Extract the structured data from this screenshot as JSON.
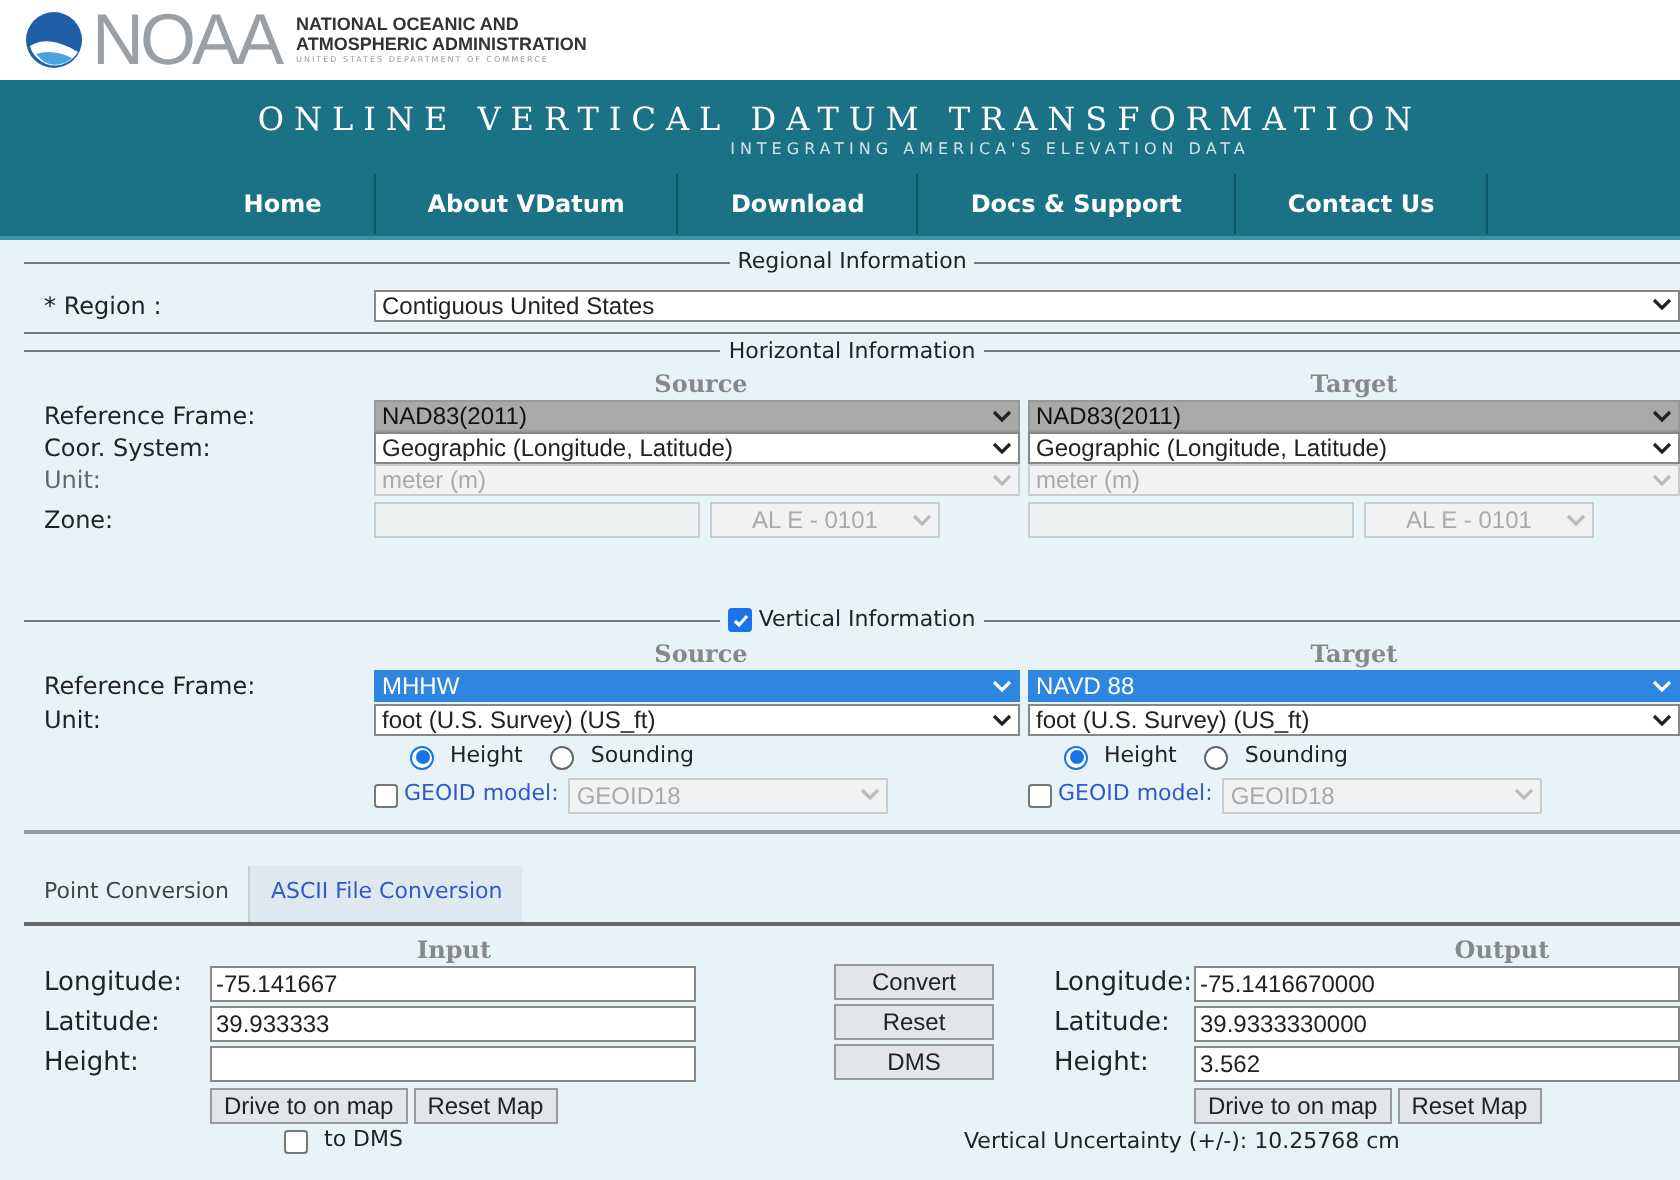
{
  "header": {
    "logo_text": "NOAA",
    "org_lines": [
      "NATIONAL OCEANIC AND",
      "ATMOSPHERIC ADMINISTRATION"
    ],
    "dept": "UNITED STATES DEPARTMENT OF COMMERCE",
    "title": "ONLINE VERTICAL DATUM TRANSFORMATION",
    "subtitle": "INTEGRATING AMERICA'S ELEVATION DATA",
    "nav": [
      {
        "label": "Home"
      },
      {
        "label": "About VDatum"
      },
      {
        "label": "Download"
      },
      {
        "label": "Docs & Support"
      },
      {
        "label": "Contact Us"
      }
    ]
  },
  "regional": {
    "legend": "Regional Information",
    "label": "* Region :",
    "value": "Contiguous United States"
  },
  "horizontal": {
    "legend": "Horizontal Information",
    "source_heading": "Source",
    "target_heading": "Target",
    "rows": [
      {
        "label": "Reference Frame:",
        "kind": "select",
        "source": {
          "value": "NAD83(2011)",
          "kind": "shaded"
        },
        "target": {
          "value": "NAD83(2011)",
          "kind": "shaded"
        }
      },
      {
        "label": "Coor. System:",
        "kind": "select",
        "source": {
          "value": "Geographic (Longitude, Latitude)",
          "kind": "plain"
        },
        "target": {
          "value": "Geographic (Longitude, Latitude)",
          "kind": "plain"
        }
      },
      {
        "label": "Unit:",
        "kind": "select",
        "source": {
          "value": "meter (m)",
          "kind": "disabled"
        },
        "target": {
          "value": "meter (m)",
          "kind": "disabled"
        }
      },
      {
        "label": "Zone:",
        "kind": "zone",
        "source": {
          "value": "AL E - 0101",
          "kind": "disabled"
        },
        "target": {
          "value": "AL E - 0101",
          "kind": "disabled"
        }
      }
    ]
  },
  "vertical": {
    "legend": "Vertical Information",
    "checked": true,
    "source_heading": "Source",
    "target_heading": "Target",
    "rows": [
      {
        "label": "Reference Frame:",
        "source": {
          "value": "MHHW",
          "kind": "highlight"
        },
        "target": {
          "value": "NAVD 88",
          "kind": "highlight"
        }
      },
      {
        "label": "Unit:",
        "source": {
          "value": "foot (U.S. Survey) (US_ft)",
          "kind": "plain"
        },
        "target": {
          "value": "foot (U.S. Survey) (US_ft)",
          "kind": "plain"
        }
      }
    ],
    "options": [
      {
        "radios": [
          {
            "label": "Height",
            "selected": true
          },
          {
            "label": "Sounding",
            "selected": false
          }
        ],
        "geoid": {
          "checked": false,
          "label": "GEOID model:",
          "value": "GEOID18"
        }
      },
      {
        "radios": [
          {
            "label": "Height",
            "selected": true
          },
          {
            "label": "Sounding",
            "selected": false
          }
        ],
        "geoid": {
          "checked": false,
          "label": "GEOID model:",
          "value": "GEOID18"
        }
      }
    ]
  },
  "tabs": [
    {
      "label": "Point Conversion",
      "selected": true
    },
    {
      "label": "ASCII File Conversion",
      "selected": false
    }
  ],
  "point": {
    "input_heading": "Input",
    "output_heading": "Output",
    "inputs": [
      {
        "label": "Longitude:",
        "value": "-75.141667"
      },
      {
        "label": "Latitude:",
        "value": "39.933333"
      },
      {
        "label": "Height:"
      }
    ],
    "outputs": [
      {
        "label": "Longitude:",
        "value": "-75.1416670000"
      },
      {
        "label": "Latitude:",
        "value": "39.9333330000"
      },
      {
        "label": "Height:",
        "value": "3.562"
      }
    ],
    "actions": [
      "Convert",
      "Reset",
      "DMS"
    ],
    "input_map_buttons": [
      "Drive to on map",
      "Reset Map"
    ],
    "output_map_buttons": [
      "Drive to on map",
      "Reset Map"
    ],
    "to_dms": {
      "label": "to DMS",
      "checked": false
    },
    "uncertainty": "Vertical Uncertainty (+/-): 10.25768 cm"
  }
}
